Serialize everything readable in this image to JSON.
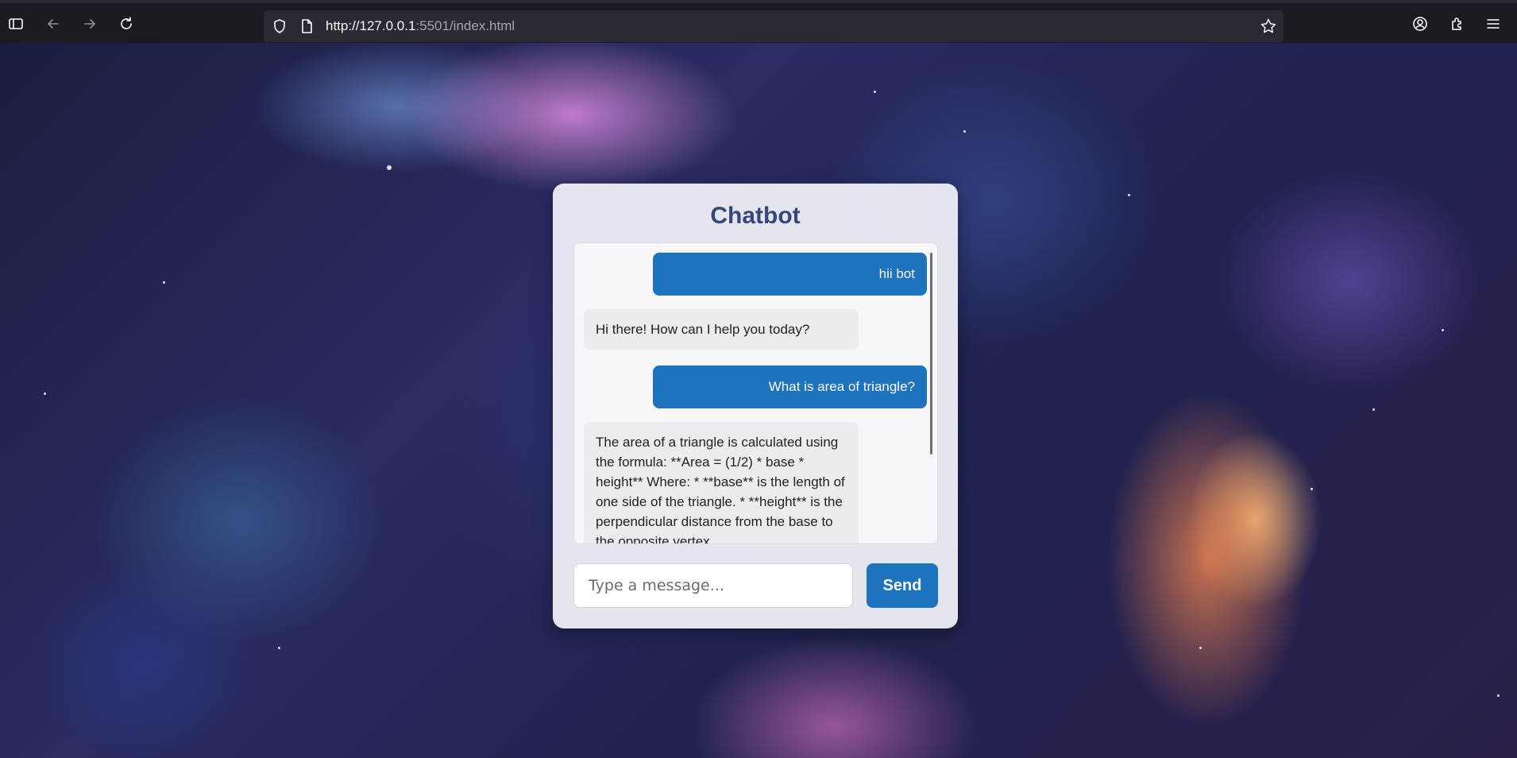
{
  "browser": {
    "url_host": "http://127.0.0.1",
    "url_port_path": ":5501/index.html"
  },
  "chat": {
    "title": "Chatbot",
    "messages": [
      {
        "role": "user",
        "text": "hii bot"
      },
      {
        "role": "bot",
        "text": "Hi there! How can I help you today?"
      },
      {
        "role": "user",
        "text": "What is area of triangle?"
      },
      {
        "role": "bot",
        "text": "The area of a triangle is calculated using the formula: **Area = (1/2) * base * height** Where: * **base** is the length of one side of the triangle. * **height** is the perpendicular distance from the base to the opposite vertex."
      }
    ],
    "input_placeholder": "Type a message...",
    "input_value": "",
    "send_label": "Send"
  },
  "colors": {
    "accent": "#1e73be",
    "title": "#34497a",
    "bot_bubble": "#ececee"
  }
}
